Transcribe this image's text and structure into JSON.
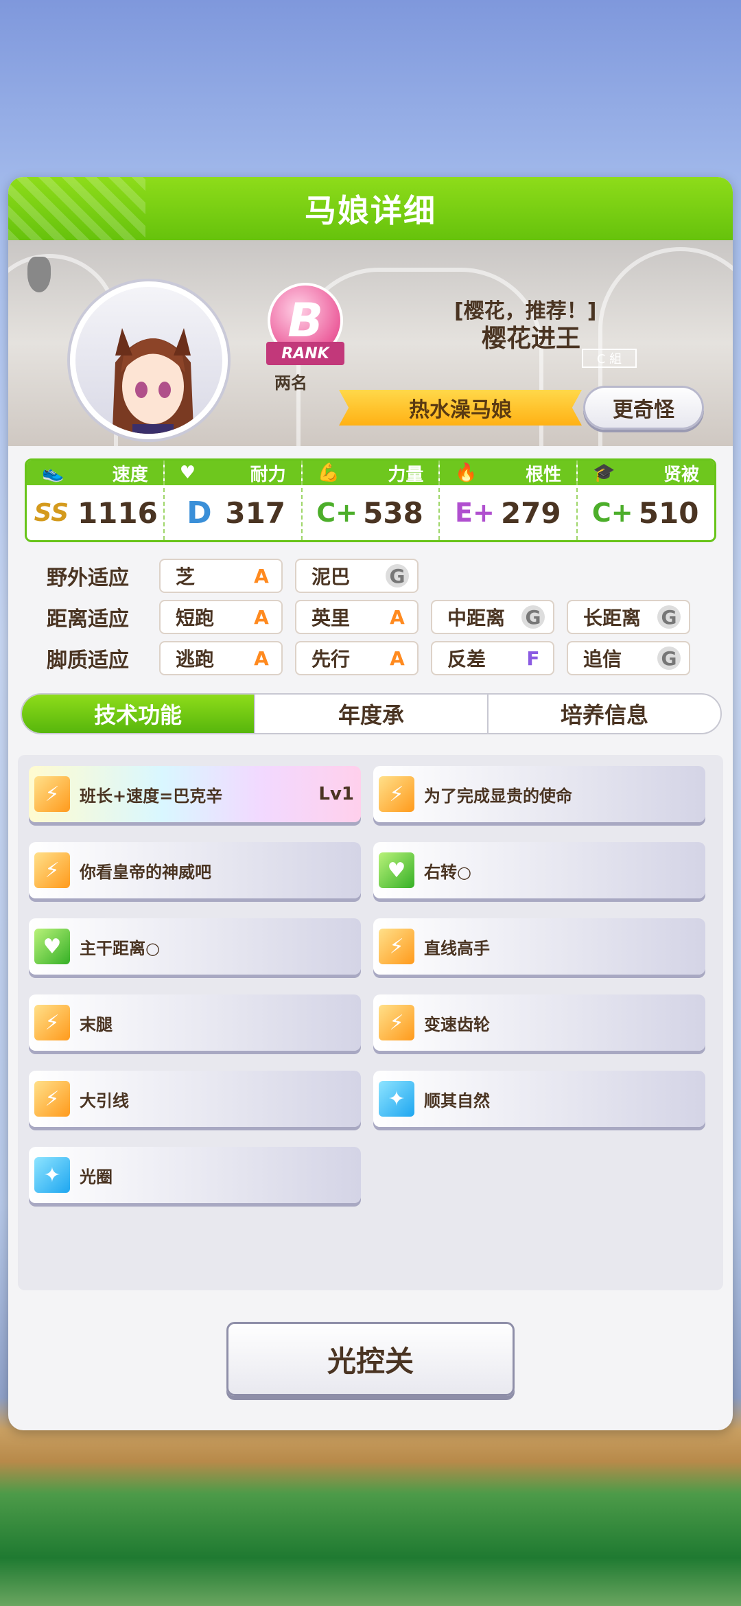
{
  "title": "马娘详细",
  "profile": {
    "rank_letter": "B",
    "rank_word": "RANK",
    "rank_sub": "两名",
    "nickname": "[樱花，推荐！]",
    "name": "樱花进王",
    "group_tag": "C 組",
    "epithet": "热水澡马娘",
    "odd_button": "更奇怪"
  },
  "stats": [
    {
      "icon": "shoe-icon",
      "label": "速度",
      "grade": "SS",
      "value": "1116",
      "color": "#d49a1d"
    },
    {
      "icon": "heart-icon",
      "label": "耐力",
      "grade": "D",
      "value": "317",
      "color": "#3a8fd8"
    },
    {
      "icon": "muscle-icon",
      "label": "力量",
      "grade": "C+",
      "value": "538",
      "color": "#4cae2a"
    },
    {
      "icon": "flame-icon",
      "label": "根性",
      "grade": "E+",
      "value": "279",
      "color": "#b04fcf"
    },
    {
      "icon": "mortarboard-icon",
      "label": "贤被",
      "grade": "C+",
      "value": "510",
      "color": "#4cae2a"
    }
  ],
  "aptitude": {
    "rows": [
      {
        "label": "野外适应",
        "cells": [
          {
            "name": "芝",
            "grade": "A"
          },
          {
            "name": "泥巴",
            "grade": "G"
          }
        ]
      },
      {
        "label": "距离适应",
        "cells": [
          {
            "name": "短跑",
            "grade": "A"
          },
          {
            "name": "英里",
            "grade": "A"
          },
          {
            "name": "中距离",
            "grade": "G"
          },
          {
            "name": "长距离",
            "grade": "G"
          }
        ]
      },
      {
        "label": "脚质适应",
        "cells": [
          {
            "name": "逃跑",
            "grade": "A"
          },
          {
            "name": "先行",
            "grade": "A"
          },
          {
            "name": "反差",
            "grade": "F"
          },
          {
            "name": "追信",
            "grade": "G"
          }
        ]
      }
    ]
  },
  "tabs": [
    "技术功能",
    "年度承",
    "培养信息"
  ],
  "skills": [
    {
      "name": "班长+速度=巴克辛",
      "level": "Lv1",
      "icon": "orange",
      "rainbow": true
    },
    {
      "name": "为了完成显贵的使命",
      "icon": "orange"
    },
    {
      "name": "你看皇帝的神威吧",
      "icon": "orange"
    },
    {
      "name": "右转○",
      "icon": "green"
    },
    {
      "name": "主干距离○",
      "icon": "green"
    },
    {
      "name": "直线高手",
      "icon": "orange"
    },
    {
      "name": "末腿",
      "icon": "orange"
    },
    {
      "name": "变速齿轮",
      "icon": "orange"
    },
    {
      "name": "大引线",
      "icon": "orange"
    },
    {
      "name": "顺其自然",
      "icon": "blue"
    },
    {
      "name": "光圈",
      "icon": "blue"
    }
  ],
  "bottom_button": "光控关"
}
